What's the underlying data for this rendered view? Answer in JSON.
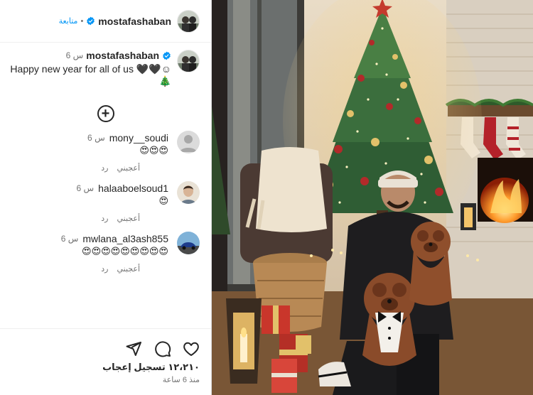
{
  "header": {
    "username": "mostafashaban",
    "follow_label": "متابعة",
    "separator": "•"
  },
  "caption": {
    "username": "mostafashaban",
    "time": "6 س",
    "text": "Happy new year for all of us 🖤🖤☺",
    "extra_glyph": "🎄"
  },
  "comments": [
    {
      "username": "mony__soudi",
      "time": "6 س",
      "text": "😍😍😍",
      "like_label": "أعجبني",
      "reply_label": "رد"
    },
    {
      "username": "halaaboelsoud1",
      "time": "6 س",
      "text": "😍",
      "like_label": "أعجبني",
      "reply_label": "رد"
    },
    {
      "username": "mwlana_al3ash855",
      "time": "6 س",
      "text": "😍😍😍😍😍😍😍😍😍",
      "like_label": "أعجبني",
      "reply_label": "رد"
    }
  ],
  "footer": {
    "likes_text": "١٢،٢١٠ تسجيل إعجاب",
    "time_ago": "منذ 6 ساعة"
  },
  "icons": [
    "plus-circle-icon",
    "share-icon",
    "comment-icon",
    "heart-icon",
    "verified-icon"
  ],
  "colors": {
    "verified_blue": "#0095f6",
    "follow_blue": "#0095f6",
    "text": "#262626",
    "muted": "#737373"
  }
}
